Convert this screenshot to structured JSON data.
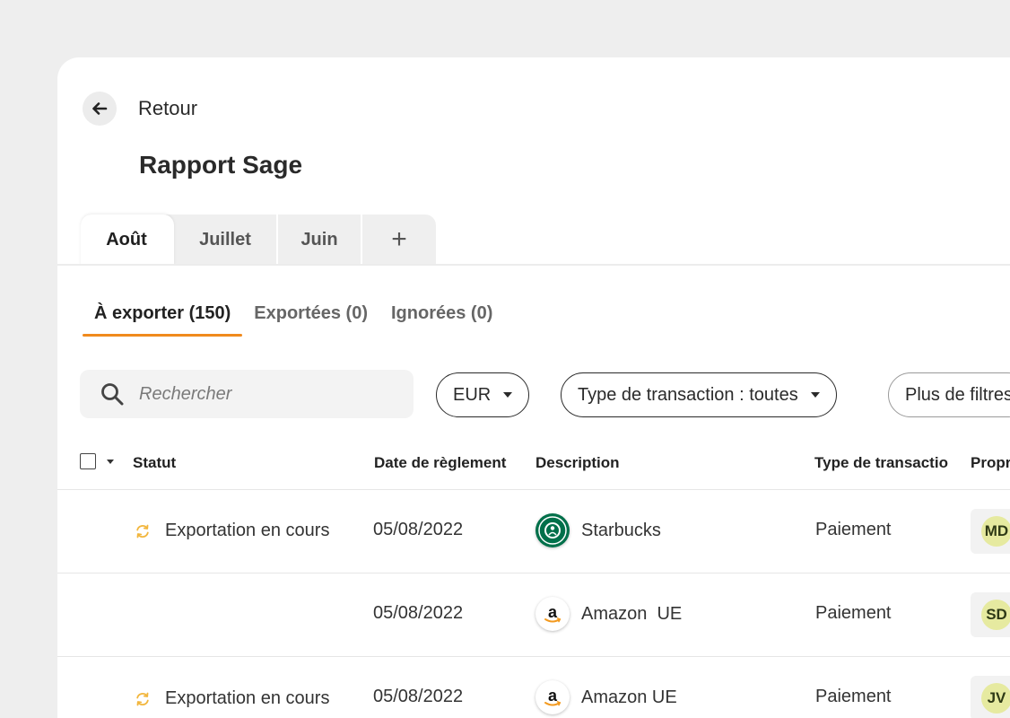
{
  "header": {
    "back_label": "Retour",
    "title": "Rapport Sage"
  },
  "month_tabs": [
    {
      "label": "Août",
      "active": true
    },
    {
      "label": "Juillet",
      "active": false
    },
    {
      "label": "Juin",
      "active": false
    },
    {
      "label": "+",
      "active": false
    }
  ],
  "status_tabs": [
    {
      "label": "À exporter (150)",
      "active": true
    },
    {
      "label": "Exportées (0)",
      "active": false
    },
    {
      "label": "Ignorées (0)",
      "active": false
    }
  ],
  "search": {
    "placeholder": "Rechercher"
  },
  "filters": {
    "currency": "EUR",
    "transaction_type": "Type de transaction : toutes",
    "more": "Plus de filtres"
  },
  "table": {
    "columns": [
      "Statut",
      "Date de règlement",
      "Description",
      "Type de transactio",
      "Propr"
    ],
    "rows": [
      {
        "status": "Exportation en cours",
        "date": "05/08/2022",
        "merchant": "Starbucks",
        "logo": "starbucks-logo",
        "type": "Paiement",
        "owner": "MD"
      },
      {
        "status": "",
        "date": "05/08/2022",
        "merchant": "Amazon  UE",
        "logo": "amazon-logo",
        "type": "Paiement",
        "owner": "SD"
      },
      {
        "status": "Exportation en cours",
        "date": "05/08/2022",
        "merchant": "Amazon UE",
        "logo": "amazon-logo",
        "type": "Paiement",
        "owner": "JV"
      }
    ]
  },
  "colors": {
    "accent": "#f08a1d",
    "sync_icon": "#f2b63d",
    "avatar_bg": "#e6eaa0",
    "starbucks_green": "#00704a"
  },
  "icons": {
    "back": "arrow-left-icon",
    "search": "search-icon",
    "sync": "sync-icon",
    "dropdown": "caret-down-icon"
  }
}
